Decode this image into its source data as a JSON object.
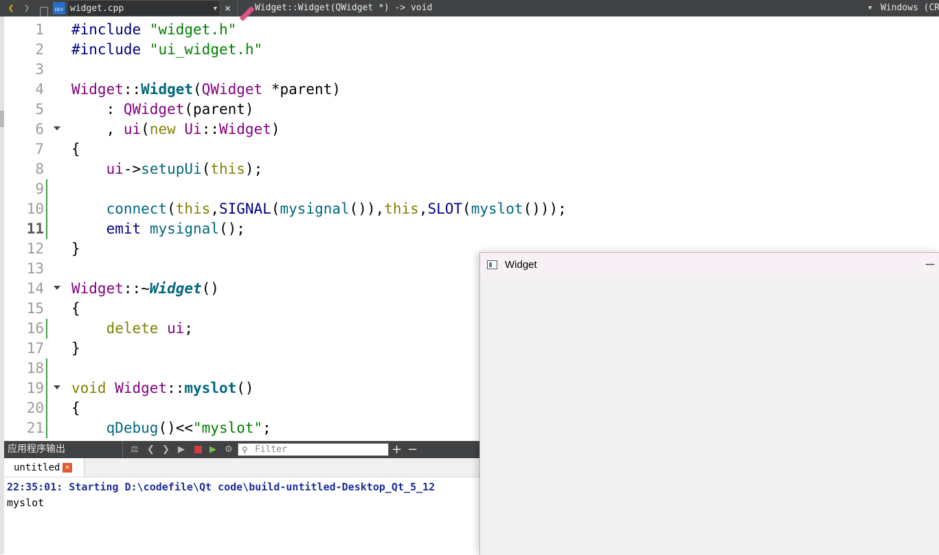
{
  "toolbar": {
    "back_icon": "chevron-left-icon",
    "forward_icon": "chevron-right-icon",
    "file_name": "widget.cpp",
    "close_label": "×",
    "symbol": "Widget::Widget(QWidget *) -> void",
    "encoding": "Windows (CR"
  },
  "editor": {
    "lines": [
      {
        "num": "1",
        "html": "<span class=\"pre\">#include</span> <span class=\"str\">\"widget.h\"</span>"
      },
      {
        "num": "2",
        "html": "<span class=\"pre\">#include</span> <span class=\"str\">\"ui_widget.h\"</span>"
      },
      {
        "num": "3",
        "html": ""
      },
      {
        "num": "4",
        "html": "<span class=\"typ\">Widget</span>::<span class=\"fn\">Widget</span>(<span class=\"typ\">QWidget</span> *parent)"
      },
      {
        "num": "5",
        "html": "    : <span class=\"typ\">QWidget</span>(parent)"
      },
      {
        "num": "6",
        "html": "    , <span class=\"typ\">ui</span>(<span class=\"kw\">new</span> <span class=\"typ\">Ui</span>::<span class=\"typ\">Widget</span>)",
        "fold": true
      },
      {
        "num": "7",
        "html": "{"
      },
      {
        "num": "8",
        "html": "    <span class=\"typ\">ui</span>-&gt;<span class=\"fnc\">setupUi</span>(<span class=\"kw\">this</span>);"
      },
      {
        "num": "9",
        "html": "",
        "changed": true
      },
      {
        "num": "10",
        "html": "    <span class=\"fnc\">connect</span>(<span class=\"kw\">this</span>,<span class=\"mac\">SIGNAL</span>(<span class=\"fnc\">mysignal</span>()),<span class=\"kw\">this</span>,<span class=\"mac\">SLOT</span>(<span class=\"fnc\">myslot</span>()));",
        "changed": true
      },
      {
        "num": "11",
        "html": "    <span class=\"sig\">emit</span> <span class=\"fnc\">mysignal</span>();",
        "changed": true,
        "current": true
      },
      {
        "num": "12",
        "html": "}"
      },
      {
        "num": "13",
        "html": ""
      },
      {
        "num": "14",
        "html": "<span class=\"typ\">Widget</span>::~<span class=\"fni\">Widget</span>()",
        "fold": true
      },
      {
        "num": "15",
        "html": "{"
      },
      {
        "num": "16",
        "html": "    <span class=\"kw\">delete</span> <span class=\"typ\">ui</span>;",
        "changed": true
      },
      {
        "num": "17",
        "html": "}"
      },
      {
        "num": "18",
        "html": "",
        "changed": true
      },
      {
        "num": "19",
        "html": "<span class=\"kw\">void</span> <span class=\"typ\">Widget</span>::<span class=\"fn\">myslot</span>()",
        "fold": true,
        "changed": true
      },
      {
        "num": "20",
        "html": "{",
        "changed": true
      },
      {
        "num": "21",
        "html": "    <span class=\"fnc\">qDebug</span>()&lt;&lt;<span class=\"str\">\"myslot\"</span>;",
        "changed": true
      }
    ]
  },
  "output": {
    "title": "应用程序输出",
    "filter_placeholder": "Filter",
    "add_label": "+",
    "remove_label": "−",
    "tab_label": "untitled",
    "tab_close": "×",
    "lines": [
      "22:35:01: Starting D:\\codefile\\Qt code\\build-untitled-Desktop_Qt_5_12",
      "myslot"
    ]
  },
  "app_window": {
    "title": "Widget",
    "minimize_label": "—"
  }
}
